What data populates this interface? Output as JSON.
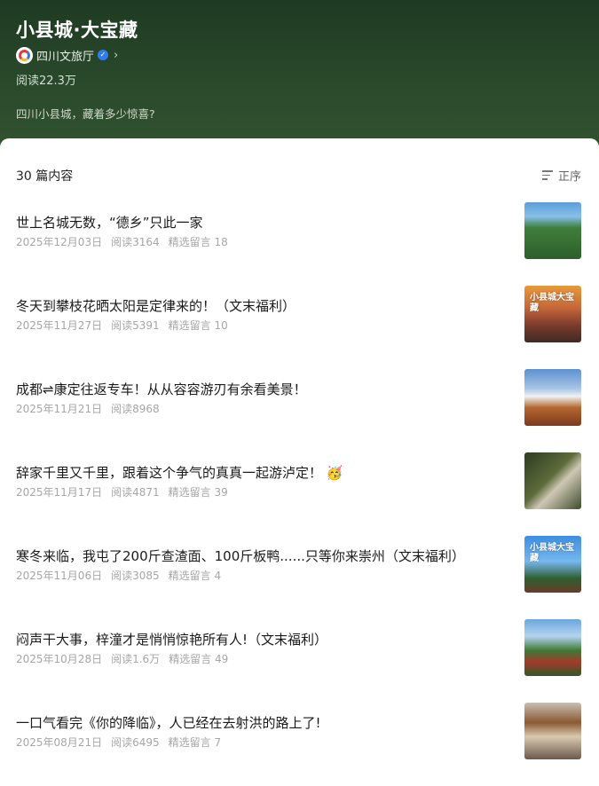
{
  "header": {
    "title": "小县城·大宝藏",
    "account_name": "四川文旅厅",
    "reads": "阅读22.3万",
    "description": "四川小县城，藏着多少惊喜?"
  },
  "list_header": {
    "count": "30 篇内容",
    "sort_label": "正序"
  },
  "articles": [
    {
      "title": "世上名城无数，“德乡”只此一家",
      "date": "2025年12月03日",
      "reads": "阅读3164",
      "comments": "精选留言 18",
      "thumb_caption": ""
    },
    {
      "title": "冬天到攀枝花晒太阳是定律来的！（文末福利）",
      "date": "2025年11月27日",
      "reads": "阅读5391",
      "comments": "精选留言 10",
      "thumb_caption": "小县城大宝藏"
    },
    {
      "title": "成都⇌康定往返专车！从从容容游刃有余看美景！",
      "date": "2025年11月21日",
      "reads": "阅读8968",
      "comments": "",
      "thumb_caption": ""
    },
    {
      "title": "辞家千里又千里，跟着这个争气的真真一起游泸定！",
      "date": "2025年11月17日",
      "reads": "阅读4871",
      "comments": "精选留言 39",
      "thumb_caption": ""
    },
    {
      "title": "寒冬来临，我屯了200斤查渣面、100斤板鸭......只等你来崇州（文末福利）",
      "date": "2025年11月06日",
      "reads": "阅读3085",
      "comments": "精选留言 4",
      "thumb_caption": "小县城大宝藏"
    },
    {
      "title": "闷声干大事，梓潼才是悄悄惊艳所有人!（文末福利）",
      "date": "2025年10月28日",
      "reads": "阅读1.6万",
      "comments": "精选留言 49",
      "thumb_caption": ""
    },
    {
      "title": "一口气看完《你的降临》，人已经在去射洪的路上了!",
      "date": "2025年08月21日",
      "reads": "阅读6495",
      "comments": "精选留言 7",
      "thumb_caption": ""
    }
  ]
}
